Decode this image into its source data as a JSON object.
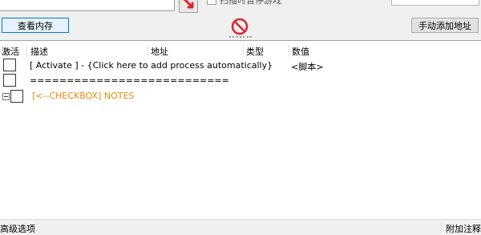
{
  "toolbar": {
    "view_memory_label": "查看内存",
    "add_address_label": "手动添加地址",
    "cutoff_option_label": "扫描时暂停游戏",
    "stop_icon": "no-entry-icon",
    "arrow_icon": "red-arrow-icon"
  },
  "table": {
    "columns": [
      "激活",
      "描述",
      "地址",
      "类型",
      "数值"
    ],
    "rows": [
      {
        "description": "[ Activate ] - {Click here to add process automatically}",
        "value": "<脚本>"
      },
      {
        "description": "===========================",
        "value": ""
      },
      {
        "description": "[<--CHECKBOX] NOTES",
        "value": ""
      }
    ]
  },
  "status_bar": {
    "left_label": "高级选项",
    "right_label": "附加注释"
  },
  "colors": {
    "notes_accent": "#e8890a",
    "stop_icon_red": "#d9262f",
    "focus_border": "#0078d7"
  }
}
